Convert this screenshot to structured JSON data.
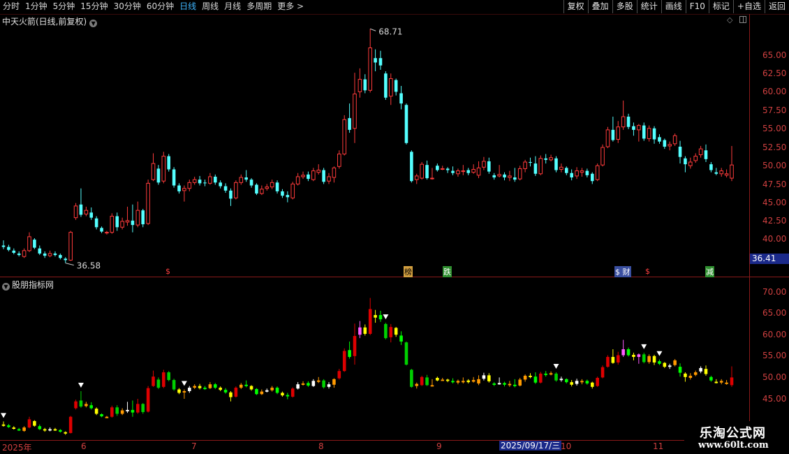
{
  "toolbar": {
    "periods": [
      "分时",
      "1分钟",
      "5分钟",
      "15分钟",
      "30分钟",
      "60分钟",
      "日线",
      "周线",
      "月线",
      "多周期",
      "更多 >"
    ],
    "active_period": "日线",
    "actions": [
      "复权",
      "叠加",
      "多股",
      "统计",
      "画线",
      "F10",
      "标记",
      "+自选",
      "返回"
    ]
  },
  "main_panel": {
    "title": "中天火箭(日线,前复权)",
    "high_label": "68.71",
    "low_label": "36.58",
    "current_price": "36.41",
    "y_ticks": [
      "65.00",
      "62.50",
      "60.00",
      "57.50",
      "55.00",
      "52.50",
      "50.00",
      "47.50",
      "45.00",
      "42.50",
      "40.00"
    ],
    "event_markers": [
      "$",
      "榜",
      "跌",
      "$ 财",
      "$",
      "减"
    ]
  },
  "sub_panel": {
    "title": "股朋指标网",
    "y_ticks": [
      "70.00",
      "65.00",
      "60.00",
      "55.00",
      "50.00",
      "45.00"
    ]
  },
  "x_axis": {
    "labels": [
      "2025年",
      "6",
      "7",
      "8",
      "9",
      "10",
      "11"
    ],
    "crosshair_date": "2025/09/17/三"
  },
  "watermark": {
    "line1": "乐淘公式网",
    "line2": "www.60lt.com"
  },
  "colors": {
    "up": "#ff3b3b",
    "down": "#54ffff",
    "axis": "#8b1a1a",
    "active_tab": "#3fb6ff"
  },
  "chart_data": {
    "type": "candlestick",
    "series_name": "中天火箭",
    "y_range": [
      38.5,
      69.5
    ],
    "candles": [
      [
        39.0,
        38.8,
        39.7,
        38.5
      ],
      [
        38.8,
        38.4,
        39.1,
        38.2
      ],
      [
        38.3,
        38.0,
        38.6,
        37.8
      ],
      [
        37.9,
        37.7,
        38.2,
        37.5
      ],
      [
        37.5,
        38.3,
        38.6,
        37.3
      ],
      [
        38.3,
        40.2,
        40.8,
        38.1
      ],
      [
        39.8,
        38.7,
        40.0,
        38.5
      ],
      [
        38.6,
        37.9,
        39.0,
        37.7
      ],
      [
        37.9,
        37.6,
        38.2,
        37.3
      ],
      [
        37.6,
        37.9,
        38.3,
        37.4
      ],
      [
        37.9,
        37.7,
        38.2,
        37.5
      ],
      [
        37.7,
        37.3,
        37.9,
        37.1
      ],
      [
        37.2,
        37.0,
        37.4,
        36.6
      ],
      [
        37.0,
        40.8,
        41.0,
        36.9
      ],
      [
        42.8,
        44.4,
        44.8,
        42.5
      ],
      [
        44.6,
        43.2,
        46.8,
        42.9
      ],
      [
        43.3,
        43.8,
        44.3,
        43.0
      ],
      [
        43.5,
        42.8,
        44.2,
        42.5
      ],
      [
        42.7,
        41.5,
        43.0,
        41.2
      ],
      [
        41.4,
        40.9,
        41.6,
        40.7
      ],
      [
        40.8,
        40.8,
        41.0,
        40.5
      ],
      [
        40.8,
        43.0,
        43.4,
        40.6
      ],
      [
        43.0,
        41.5,
        43.5,
        41.0
      ],
      [
        41.5,
        42.3,
        42.8,
        41.2
      ],
      [
        42.2,
        42.4,
        44.3,
        41.7
      ],
      [
        42.4,
        41.8,
        44.6,
        40.8
      ],
      [
        41.8,
        43.8,
        45.0,
        41.5
      ],
      [
        43.8,
        41.9,
        44.0,
        41.5
      ],
      [
        42.0,
        47.5,
        48.0,
        41.8
      ],
      [
        48.0,
        50.2,
        51.6,
        47.8
      ],
      [
        49.5,
        47.6,
        50.0,
        47.3
      ],
      [
        47.8,
        51.2,
        51.8,
        47.5
      ],
      [
        51.2,
        49.4,
        51.5,
        49.1
      ],
      [
        49.4,
        47.2,
        49.7,
        46.9
      ],
      [
        47.2,
        46.4,
        47.5,
        46.1
      ],
      [
        46.5,
        46.8,
        47.2,
        45.0
      ],
      [
        46.8,
        47.6,
        48.0,
        46.4
      ],
      [
        47.6,
        48.0,
        48.4,
        47.3
      ],
      [
        48.0,
        47.5,
        48.5,
        47.2
      ],
      [
        47.6,
        47.5,
        48.0,
        47.1
      ],
      [
        47.5,
        48.4,
        48.9,
        47.3
      ],
      [
        48.4,
        47.6,
        48.7,
        47.3
      ],
      [
        47.6,
        47.1,
        47.9,
        46.8
      ],
      [
        47.1,
        46.5,
        47.5,
        46.2
      ],
      [
        46.5,
        45.4,
        46.8,
        44.4
      ],
      [
        45.5,
        47.6,
        47.9,
        45.3
      ],
      [
        47.6,
        48.3,
        48.7,
        47.3
      ],
      [
        48.3,
        48.0,
        49.3,
        47.7
      ],
      [
        48.0,
        47.2,
        48.2,
        46.9
      ],
      [
        47.3,
        46.1,
        47.5,
        45.9
      ],
      [
        46.1,
        46.7,
        47.2,
        45.9
      ],
      [
        46.8,
        47.0,
        47.4,
        46.5
      ],
      [
        47.0,
        47.6,
        48.0,
        46.7
      ],
      [
        47.6,
        46.4,
        47.9,
        46.1
      ],
      [
        46.4,
        45.8,
        46.7,
        45.5
      ],
      [
        45.9,
        45.6,
        46.4,
        44.9
      ],
      [
        45.5,
        47.4,
        47.7,
        45.3
      ],
      [
        47.4,
        48.4,
        48.9,
        47.2
      ],
      [
        48.4,
        48.6,
        49.1,
        48.1
      ],
      [
        48.7,
        48.1,
        49.1,
        47.8
      ],
      [
        48.0,
        49.2,
        49.6,
        47.8
      ],
      [
        49.0,
        49.3,
        50.1,
        48.7
      ],
      [
        49.3,
        47.7,
        49.6,
        47.4
      ],
      [
        47.8,
        48.4,
        48.9,
        47.4
      ],
      [
        48.3,
        49.6,
        49.8,
        47.6
      ],
      [
        49.8,
        51.5,
        52.0,
        49.5
      ],
      [
        51.5,
        56.2,
        56.8,
        51.3
      ],
      [
        56.4,
        54.8,
        58.4,
        54.4
      ],
      [
        55.0,
        59.7,
        62.6,
        53.0
      ],
      [
        60.0,
        61.7,
        63.2,
        59.2
      ],
      [
        61.7,
        60.2,
        62.4,
        59.8
      ],
      [
        60.2,
        66.0,
        68.6,
        59.9
      ],
      [
        64.6,
        64.0,
        65.8,
        62.8
      ],
      [
        64.6,
        63.6,
        65.6,
        63.0
      ],
      [
        62.5,
        59.2,
        62.8,
        58.9
      ],
      [
        59.4,
        61.8,
        62.5,
        58.2
      ],
      [
        61.6,
        60.0,
        61.8,
        59.5
      ],
      [
        59.8,
        58.4,
        60.8,
        57.6
      ],
      [
        58.2,
        53.0,
        58.4,
        52.8
      ],
      [
        51.8,
        47.8,
        52.0,
        47.6
      ],
      [
        48.0,
        48.5,
        48.8,
        47.4
      ],
      [
        48.2,
        50.1,
        50.4,
        48.0
      ],
      [
        50.0,
        48.2,
        50.6,
        48.0
      ],
      [
        48.2,
        48.2,
        49.6,
        48.0
      ],
      [
        49.9,
        49.3,
        50.2,
        49.1
      ],
      [
        49.4,
        49.5,
        49.9,
        49.3
      ],
      [
        49.5,
        49.3,
        49.7,
        48.9
      ],
      [
        49.2,
        48.9,
        49.8,
        48.6
      ],
      [
        48.8,
        49.2,
        49.5,
        48.4
      ],
      [
        49.1,
        49.2,
        50.0,
        48.6
      ],
      [
        49.3,
        48.9,
        49.6,
        48.6
      ],
      [
        49.0,
        49.4,
        50.1,
        48.8
      ],
      [
        48.6,
        49.6,
        50.5,
        48.2
      ],
      [
        49.7,
        50.5,
        51.1,
        49.3
      ],
      [
        50.5,
        49.1,
        51.0,
        48.8
      ],
      [
        48.6,
        48.3,
        48.9,
        48.0
      ],
      [
        48.5,
        48.7,
        50.0,
        48.3
      ],
      [
        48.7,
        48.3,
        49.0,
        47.9
      ],
      [
        48.3,
        48.5,
        49.2,
        47.8
      ],
      [
        48.3,
        48.0,
        49.6,
        47.7
      ],
      [
        48.1,
        49.5,
        49.9,
        47.9
      ],
      [
        49.5,
        50.4,
        50.7,
        49.0
      ],
      [
        50.4,
        50.3,
        51.0,
        49.8
      ],
      [
        50.2,
        48.8,
        51.2,
        48.5
      ],
      [
        48.8,
        50.9,
        51.3,
        48.6
      ],
      [
        50.9,
        50.7,
        51.5,
        50.2
      ],
      [
        50.7,
        51.0,
        51.4,
        50.5
      ],
      [
        50.9,
        49.3,
        51.2,
        49.0
      ],
      [
        49.4,
        49.7,
        50.2,
        49.0
      ],
      [
        49.6,
        48.9,
        49.8,
        48.6
      ],
      [
        48.9,
        48.3,
        49.4,
        47.9
      ],
      [
        48.5,
        49.2,
        49.7,
        48.1
      ],
      [
        49.0,
        49.2,
        49.6,
        48.4
      ],
      [
        49.2,
        48.6,
        49.5,
        48.3
      ],
      [
        48.8,
        47.8,
        49.0,
        47.4
      ],
      [
        48.0,
        49.9,
        50.2,
        47.8
      ],
      [
        50.0,
        52.4,
        52.8,
        49.8
      ],
      [
        52.5,
        54.8,
        55.2,
        52.3
      ],
      [
        54.8,
        53.4,
        56.6,
        53.2
      ],
      [
        53.5,
        55.2,
        56.0,
        53.0
      ],
      [
        55.2,
        56.6,
        58.8,
        54.8
      ],
      [
        56.6,
        55.2,
        57.0,
        54.9
      ],
      [
        55.3,
        54.8,
        55.8,
        54.0
      ],
      [
        54.8,
        55.4,
        55.6,
        53.2
      ],
      [
        55.4,
        53.6,
        55.8,
        53.3
      ],
      [
        53.6,
        55.0,
        55.4,
        53.2
      ],
      [
        55.0,
        53.5,
        55.3,
        52.9
      ],
      [
        53.8,
        53.2,
        54.2,
        52.9
      ],
      [
        53.4,
        52.5,
        53.6,
        52.2
      ],
      [
        52.6,
        52.8,
        53.2,
        52.0
      ],
      [
        52.9,
        54.0,
        54.3,
        52.6
      ],
      [
        52.5,
        51.1,
        53.3,
        50.2
      ],
      [
        50.9,
        50.1,
        51.2,
        49.0
      ],
      [
        49.9,
        50.4,
        51.0,
        49.5
      ],
      [
        50.6,
        51.2,
        51.6,
        50.3
      ],
      [
        51.4,
        52.2,
        52.6,
        51.0
      ],
      [
        52.0,
        50.8,
        52.8,
        50.4
      ],
      [
        50.1,
        49.3,
        50.4,
        49.0
      ],
      [
        49.0,
        48.8,
        49.6,
        48.6
      ],
      [
        48.8,
        49.2,
        49.6,
        48.4
      ],
      [
        48.6,
        48.8,
        49.4,
        48.3
      ],
      [
        48.2,
        50.0,
        52.6,
        47.8
      ]
    ]
  }
}
